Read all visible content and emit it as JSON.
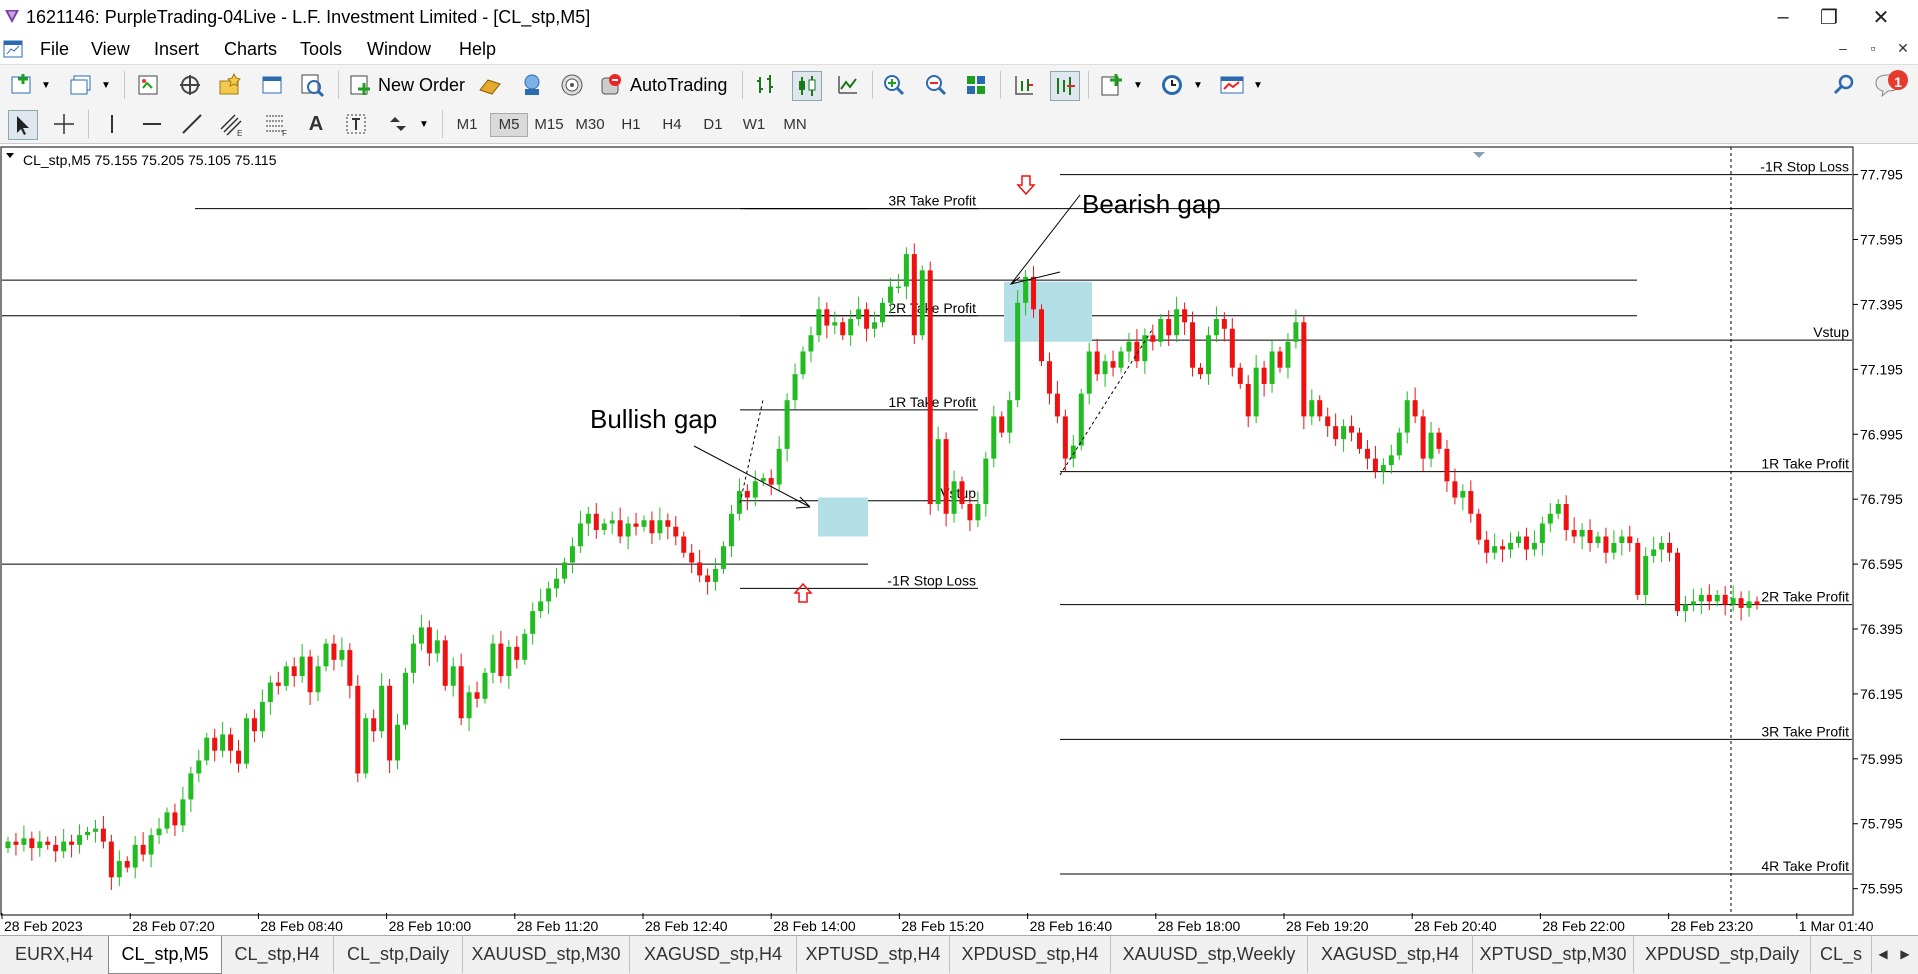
{
  "window": {
    "title": "1621146: PurpleTrading-04Live - L.F. Investment Limited - [CL_stp,M5]",
    "minimize": "–",
    "maximize": "❐",
    "close": "✕"
  },
  "menu": {
    "items": [
      "File",
      "View",
      "Insert",
      "Charts",
      "Tools",
      "Window",
      "Help"
    ],
    "mdi": [
      "–",
      "▫",
      "✕"
    ]
  },
  "toolbar": {
    "new_order": "New Order",
    "autotrading": "AutoTrading",
    "notification_count": "1",
    "timeframes": [
      "M1",
      "M5",
      "M15",
      "M30",
      "H1",
      "H4",
      "D1",
      "W1",
      "MN"
    ],
    "active_timeframe": "M5"
  },
  "chart_data": {
    "type": "candlestick",
    "header": "CL_stp,M5  75.155 75.205 75.105 75.115",
    "symbol": "CL_stp,M5",
    "yticks": [
      "77.795",
      "77.595",
      "77.395",
      "77.195",
      "76.995",
      "76.795",
      "76.595",
      "76.395",
      "76.195",
      "75.995",
      "75.795",
      "75.595"
    ],
    "ylim": [
      75.52,
      77.88
    ],
    "xticks": [
      "28 Feb 2023",
      "28 Feb 07:20",
      "28 Feb 08:40",
      "28 Feb 10:00",
      "28 Feb 11:20",
      "28 Feb 12:40",
      "28 Feb 14:00",
      "28 Feb 15:20",
      "28 Feb 16:40",
      "28 Feb 18:00",
      "28 Feb 19:20",
      "28 Feb 20:40",
      "28 Feb 22:00",
      "28 Feb 23:20",
      "1 Mar 01:40"
    ],
    "up_color": "#22bb22",
    "down_color": "#ee1111",
    "close_path": [
      75.74,
      75.73,
      75.75,
      75.72,
      75.74,
      75.73,
      75.71,
      75.74,
      75.73,
      75.76,
      75.77,
      75.78,
      75.74,
      75.63,
      75.68,
      75.66,
      75.73,
      75.7,
      75.76,
      75.78,
      75.83,
      75.79,
      75.87,
      75.95,
      75.99,
      76.06,
      76.02,
      76.07,
      76.02,
      75.98,
      76.12,
      76.08,
      76.17,
      76.23,
      76.22,
      76.28,
      76.25,
      76.31,
      76.2,
      76.28,
      76.35,
      76.3,
      76.33,
      76.22,
      75.95,
      76.12,
      76.08,
      76.22,
      75.99,
      76.1,
      76.26,
      76.35,
      76.4,
      76.32,
      76.36,
      76.22,
      76.28,
      76.12,
      76.2,
      76.18,
      76.26,
      76.35,
      76.25,
      76.34,
      76.3,
      76.38,
      76.45,
      76.48,
      76.52,
      76.55,
      76.6,
      76.65,
      76.72,
      76.75,
      76.7,
      76.72,
      76.73,
      76.68,
      76.72,
      76.71,
      76.73,
      76.69,
      76.73,
      76.71,
      76.68,
      76.63,
      76.6,
      76.56,
      76.54,
      76.58,
      76.65,
      76.75,
      76.82,
      76.8,
      76.85,
      76.86,
      76.84,
      76.95,
      77.1,
      77.18,
      77.25,
      77.3,
      77.38,
      77.33,
      77.34,
      77.3,
      77.35,
      77.38,
      77.32,
      77.34,
      77.4,
      77.45,
      77.45,
      77.55,
      77.3,
      77.5,
      76.78,
      76.98,
      76.75,
      76.85,
      76.78,
      76.73,
      76.78,
      76.92,
      77.05,
      77.0,
      77.1,
      77.4,
      77.48,
      77.38,
      77.22,
      77.12,
      77.05,
      76.92,
      76.96,
      77.12,
      77.25,
      77.18,
      77.22,
      77.2,
      77.25,
      77.28,
      77.22,
      77.3,
      77.28,
      77.35,
      77.3,
      77.38,
      77.34,
      77.2,
      77.18,
      77.3,
      77.35,
      77.32,
      77.2,
      77.15,
      77.05,
      77.2,
      77.15,
      77.25,
      77.2,
      77.28,
      77.34,
      77.05,
      77.1,
      77.05,
      77.02,
      76.98,
      77.02,
      77.0,
      76.95,
      76.92,
      76.88,
      76.9,
      76.93,
      77.0,
      77.1,
      77.05,
      76.92,
      77.0,
      76.95,
      76.85,
      76.8,
      76.82,
      76.75,
      76.67,
      76.63,
      76.65,
      76.64,
      76.66,
      76.68,
      76.64,
      76.66,
      76.72,
      76.75,
      76.78,
      76.7,
      76.68,
      76.7,
      76.66,
      76.68,
      76.63,
      76.66,
      76.68,
      76.66,
      76.5,
      76.62,
      76.64,
      76.66,
      76.63,
      76.45,
      76.47,
      76.48,
      76.5,
      76.48,
      76.5,
      76.47,
      76.49,
      76.46,
      76.48,
      76.47
    ],
    "horizontal_lines": [
      {
        "price": 77.795,
        "label": "-1R Stop Loss"
      },
      {
        "price": 77.285,
        "label": "Vstup"
      },
      {
        "price": 76.88,
        "label": "1R Take Profit"
      },
      {
        "price": 76.47,
        "label": "2R Take Profit"
      },
      {
        "price": 76.055,
        "label": "3R Take Profit"
      },
      {
        "price": 75.64,
        "label": "4R Take Profit"
      },
      {
        "price": 77.69,
        "label": "3R Take Profit"
      },
      {
        "price": 77.36,
        "label": "2R Take Profit"
      },
      {
        "price": 77.07,
        "label": "1R Take Profit"
      },
      {
        "price": 76.79,
        "label": "Vstup"
      },
      {
        "price": 76.52,
        "label": "-1R Stop Loss"
      }
    ],
    "gaps": [
      {
        "label": "Bullish gap",
        "low": 76.68,
        "high": 76.8
      },
      {
        "label": "Bearish gap",
        "low": 77.28,
        "high": 77.465
      }
    ],
    "annotations": [
      "Bullish gap",
      "Bearish gap"
    ]
  },
  "tabs": {
    "items": [
      "EURX,H4",
      "CL_stp,M5",
      "CL_stp,H4",
      "CL_stp,Daily",
      "XAUUSD_stp,M30",
      "XAGUSD_stp,H4",
      "XPTUSD_stp,H4",
      "XPDUSD_stp,H4",
      "XAUUSD_stp,Weekly",
      "XAGUSD_stp,H4",
      "XPTUSD_stp,M30",
      "XPDUSD_stp,Daily",
      "CL_s"
    ],
    "active": "CL_stp,M5"
  }
}
